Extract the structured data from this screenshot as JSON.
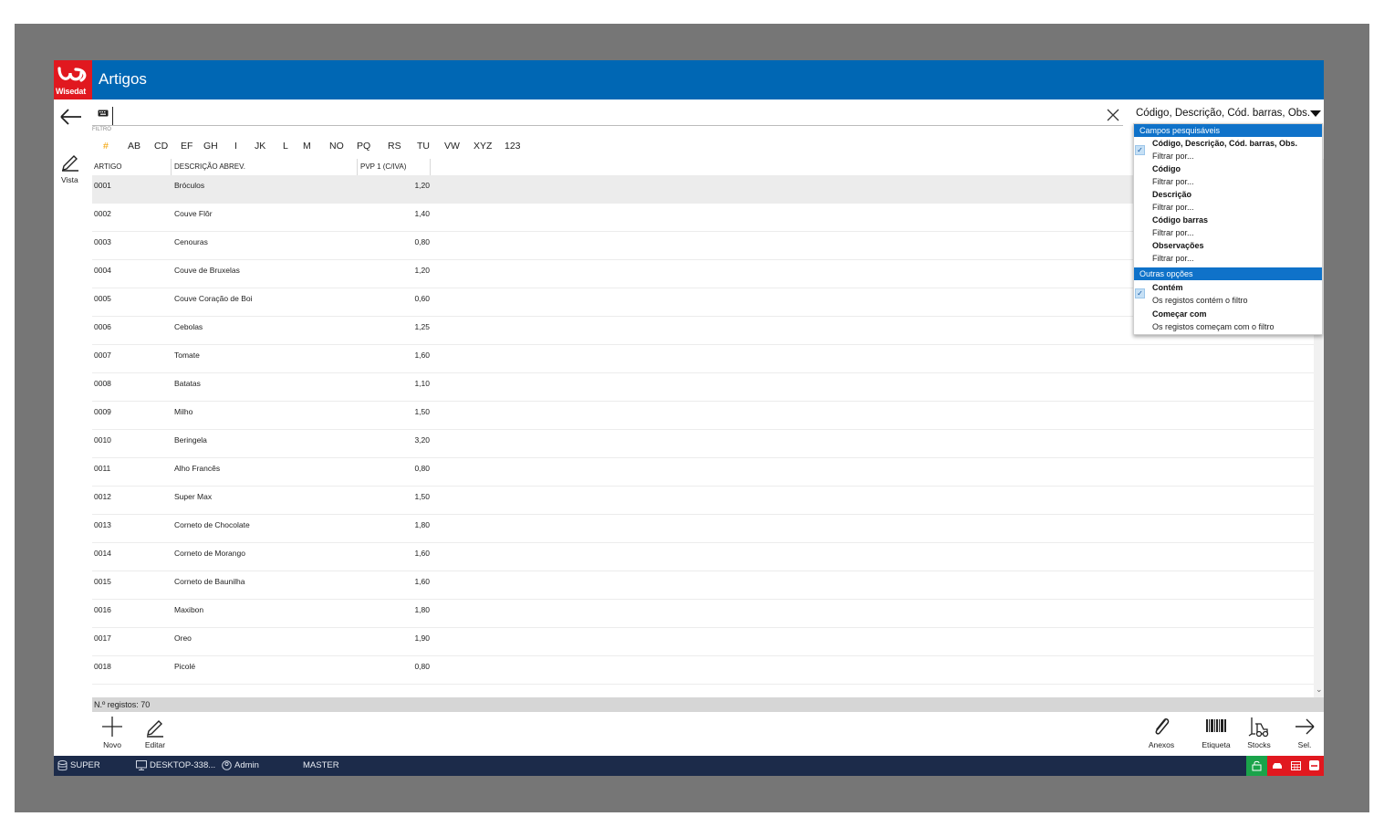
{
  "window": {
    "title": "Artigos",
    "logo_text": "Wisedat"
  },
  "search": {
    "value": "",
    "filter_label": "FILTRO",
    "fields_selected": "Código, Descrição, Cód. barras, Obs."
  },
  "vista": {
    "label": "Vista"
  },
  "letters": [
    "#",
    "AB",
    "CD",
    "EF",
    "GH",
    "I",
    "JK",
    "L",
    "M",
    "NO",
    "PQ",
    "RS",
    "TU",
    "VW",
    "XYZ",
    "123"
  ],
  "active_letter": "#",
  "table": {
    "columns": [
      "ARTIGO",
      "DESCRIÇÃO ABREV.",
      "PVP 1 (C/IVA)"
    ],
    "rows": [
      {
        "code": "0001",
        "desc": "Bróculos",
        "price": "1,20"
      },
      {
        "code": "0002",
        "desc": "Couve Flôr",
        "price": "1,40"
      },
      {
        "code": "0003",
        "desc": "Cenouras",
        "price": "0,80"
      },
      {
        "code": "0004",
        "desc": "Couve de Bruxelas",
        "price": "1,20"
      },
      {
        "code": "0005",
        "desc": "Couve Coração de Boi",
        "price": "0,60"
      },
      {
        "code": "0006",
        "desc": "Cebolas",
        "price": "1,25"
      },
      {
        "code": "0007",
        "desc": "Tomate",
        "price": "1,60"
      },
      {
        "code": "0008",
        "desc": "Batatas",
        "price": "1,10"
      },
      {
        "code": "0009",
        "desc": "Milho",
        "price": "1,50"
      },
      {
        "code": "0010",
        "desc": "Beringela",
        "price": "3,20"
      },
      {
        "code": "0011",
        "desc": "Alho Francês",
        "price": "0,80"
      },
      {
        "code": "0012",
        "desc": "Super Max",
        "price": "1,50"
      },
      {
        "code": "0013",
        "desc": "Corneto de Chocolate",
        "price": "1,80"
      },
      {
        "code": "0014",
        "desc": "Corneto de Morango",
        "price": "1,60"
      },
      {
        "code": "0015",
        "desc": "Corneto de Baunilha",
        "price": "1,60"
      },
      {
        "code": "0016",
        "desc": "Maxibon",
        "price": "1,80"
      },
      {
        "code": "0017",
        "desc": "Oreo",
        "price": "1,90"
      },
      {
        "code": "0018",
        "desc": "Picolé",
        "price": "0,80"
      }
    ],
    "selected_row": 0
  },
  "record_count": "N.º registos: 70",
  "toolbar": {
    "new": "Novo",
    "edit": "Editar",
    "attachments": "Anexos",
    "label": "Etiqueta",
    "stocks": "Stocks",
    "select": "Sel."
  },
  "footer": {
    "database": "SUPER",
    "computer": "DESKTOP-338...",
    "user": "Admin",
    "company": "MASTER"
  },
  "dropdown": {
    "searchable_header": "Campos pesquisáveis",
    "fields": [
      {
        "title": "Código, Descrição, Cód. barras, Obs.",
        "sub": "Filtrar por...",
        "checked": true
      },
      {
        "title": "Código",
        "sub": "Filtrar por...",
        "checked": false
      },
      {
        "title": "Descrição",
        "sub": "Filtrar por...",
        "checked": false
      },
      {
        "title": "Código barras",
        "sub": "Filtrar por...",
        "checked": false
      },
      {
        "title": "Observações",
        "sub": "Filtrar por...",
        "checked": false
      }
    ],
    "other_header": "Outras opções",
    "options": [
      {
        "title": "Contém",
        "sub": "Os registos contém o filtro",
        "checked": true
      },
      {
        "title": "Começar com",
        "sub": "Os registos começam com o filtro",
        "checked": false
      }
    ]
  },
  "colors": {
    "titlebar": "#0067b4",
    "logo": "#e1181f",
    "accent_letter": "#f2a100",
    "footer": "#1c2b4a",
    "dropdown_header": "#0f72c9",
    "status_green": "#1aa34a",
    "status_red": "#e1181f"
  },
  "icons": {
    "back": "arrow-left-icon",
    "keyboard": "keyboard-icon",
    "clear": "close-icon",
    "vista": "pencil-icon",
    "new": "plus-icon",
    "edit": "pencil-icon",
    "attachments": "paperclip-icon",
    "label": "barcode-icon",
    "stocks": "forklift-icon",
    "select": "arrow-right-icon"
  }
}
